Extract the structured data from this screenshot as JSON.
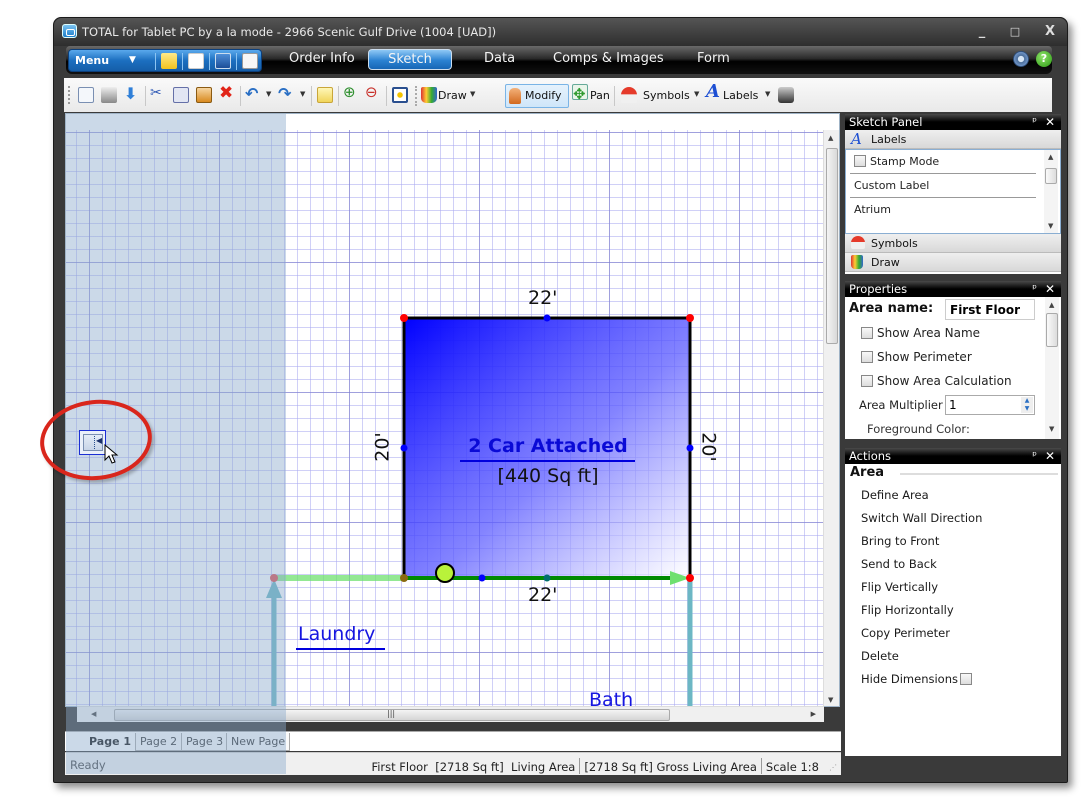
{
  "window": {
    "title": "TOTAL for Tablet PC by a la mode - 2966 Scenic Gulf Drive (1004 [UAD])",
    "controls": {
      "minimize": "_",
      "maximize": "□",
      "close": "X"
    }
  },
  "menubar": {
    "menu_label": "Menu",
    "quick_access": [
      "open-folder-icon",
      "new-document-icon",
      "save-icon",
      "edit-form-icon"
    ],
    "tabs": [
      {
        "label": "Order Info",
        "active": false
      },
      {
        "label": "Sketch",
        "active": true
      },
      {
        "label": "Data",
        "active": false
      },
      {
        "label": "Comps & Images",
        "active": false
      },
      {
        "label": "Form",
        "active": false
      }
    ],
    "settings_icon": "gear-icon",
    "help_label": "?"
  },
  "toolbar": {
    "icons": [
      "print-preview-icon",
      "print-icon",
      "download-arrow-icon",
      "cut-icon",
      "copy-icon",
      "paste-icon",
      "delete-icon",
      "undo-icon",
      "redo-icon",
      "notes-icon",
      "zoom-in-icon",
      "zoom-out-icon",
      "fit-page-icon"
    ],
    "draw_label": "Draw",
    "modify_label": "Modify",
    "pan_label": "Pan",
    "symbols_label": "Symbols",
    "labels_label": "Labels"
  },
  "sketch": {
    "area": {
      "name": "2 Car Attached",
      "size": "[440 Sq ft]",
      "dim_top": "22'",
      "dim_bottom": "22'",
      "dim_left": "20'",
      "dim_right": "20'",
      "fill_color": "#0000ff"
    },
    "labels": [
      "Laundry",
      "Bath",
      "Bath"
    ]
  },
  "page_tabs": [
    {
      "label": "Page 1",
      "active": true
    },
    {
      "label": "Page 2",
      "active": false
    },
    {
      "label": "Page 3",
      "active": false
    },
    {
      "label": "New Page",
      "active": false
    }
  ],
  "status": {
    "ready": "Ready",
    "floor": "First Floor  [2718 Sq ft]  Living Area",
    "gla": "[2718 Sq ft] Gross Living Area",
    "scale": "Scale 1:8"
  },
  "sketch_panel": {
    "title": "Sketch Panel",
    "labels_section": "Labels",
    "stamp_mode": "Stamp Mode",
    "items": [
      "Custom Label",
      "Atrium"
    ],
    "symbols_section": "Symbols",
    "draw_section": "Draw"
  },
  "properties": {
    "title": "Properties",
    "area_name_label": "Area name:",
    "area_name_value": "First Floor",
    "show_area_name": "Show Area Name",
    "show_perimeter": "Show Perimeter",
    "show_area_calc": "Show Area Calculation",
    "multiplier_label": "Area Multiplier",
    "multiplier_value": "1",
    "foreground_color": "Foreground Color:"
  },
  "actions": {
    "title": "Actions",
    "section": "Area",
    "items": [
      "Define Area",
      "Switch Wall Direction",
      "Bring to Front",
      "Send to Back",
      "Flip Vertically",
      "Flip Horizontally",
      "Copy Perimeter",
      "Delete"
    ],
    "hide_dimensions": "Hide Dimensions"
  }
}
